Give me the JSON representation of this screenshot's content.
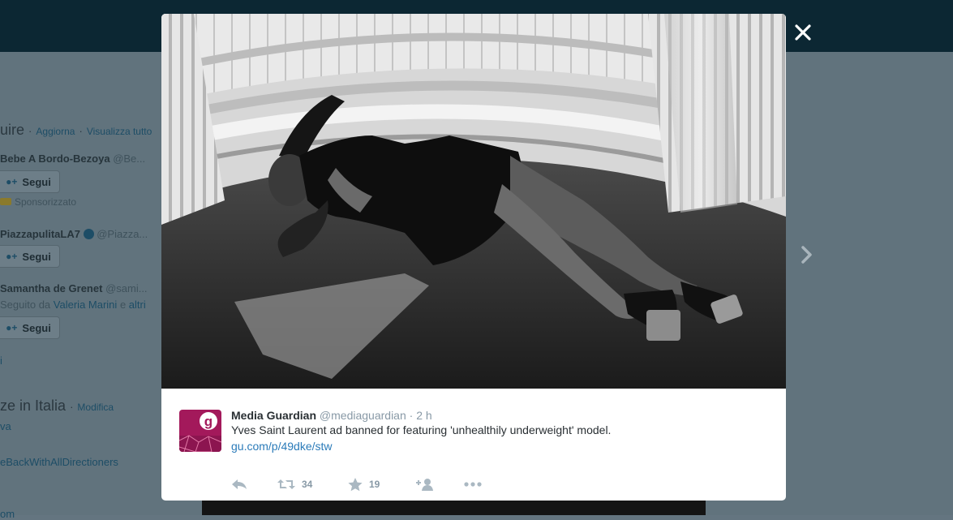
{
  "sidebar": {
    "who_to_follow": {
      "title_fragment": "uire",
      "refresh_link": "Aggiorna",
      "view_all_link": "Visualizza tutto",
      "separator": "·"
    },
    "suggestions": [
      {
        "name": "Bebe A Bordo-Bezoya",
        "handle": "@Be...",
        "follow_label": "Segui",
        "promoted_label": "Sponsorizzato"
      },
      {
        "name": "PiazzapulitaLA7",
        "handle": "@Piazza...",
        "follow_label": "Segui"
      },
      {
        "name": "Samantha de Grenet",
        "handle": "@sami...",
        "followed_by_prefix": "Seguito da",
        "followed_by_name": "Valeria Marini",
        "followed_by_suffix": "e",
        "followed_by_more": "altri",
        "follow_label": "Segui"
      }
    ],
    "fragment_i": "i",
    "trends": {
      "title_fragment": "ze in Italia",
      "separator": "·",
      "change_link": "Modifica",
      "items": [
        "va",
        "eBackWithAllDirectioners",
        "om"
      ]
    }
  },
  "tweet": {
    "author_name": "Media Guardian",
    "author_handle": "@mediaguardian",
    "separator": "·",
    "time": "2 h",
    "text": "Yves Saint Laurent ad banned for featuring 'unhealthily underweight' model.",
    "link": "gu.com/p/49dke/stw",
    "retweet_count": "34",
    "favorite_count": "19",
    "avatar_letter": "g"
  },
  "colors": {
    "link": "#2b7bb9",
    "muted": "#8899a6",
    "text": "#292f33",
    "avatar_bg": "#a3195b",
    "topbar": "#0c2733"
  },
  "icons": [
    "close-icon",
    "chevron-right-icon",
    "reply-icon",
    "retweet-icon",
    "favorite-icon",
    "follow-icon",
    "more-icon"
  ]
}
